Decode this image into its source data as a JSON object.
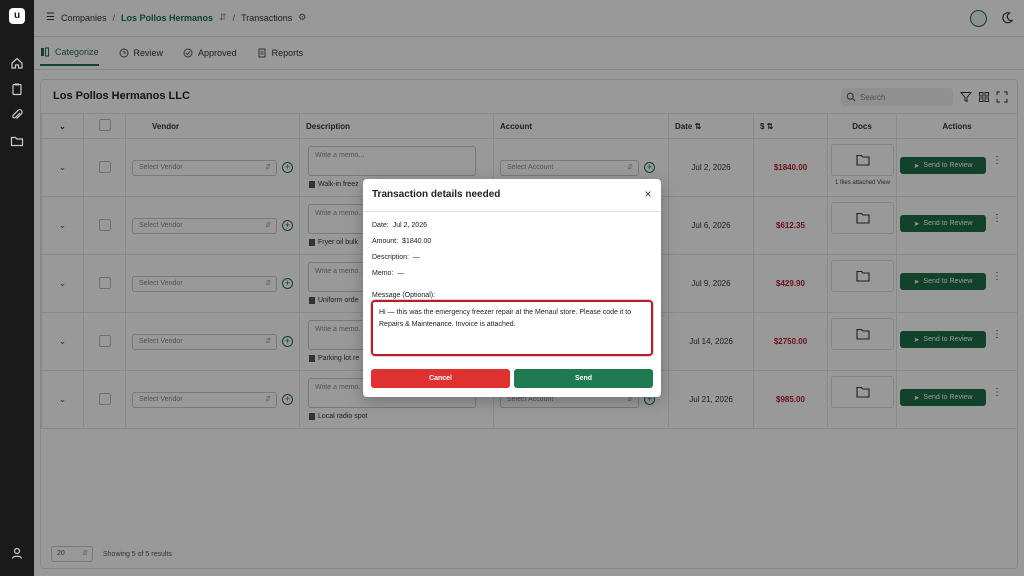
{
  "header": {
    "menu_icon": "hamburger-icon",
    "crumb_root": "Companies",
    "crumb_company": "Los Pollos Hermanos LLC",
    "crumb_sep": "/",
    "crumb_page": "Transactions"
  },
  "tabs": [
    {
      "label": "Categorize",
      "icon": "categorize-icon"
    },
    {
      "label": "Review",
      "icon": "clock-icon"
    },
    {
      "label": "Approved",
      "icon": "check-circle-icon"
    },
    {
      "label": "Reports",
      "icon": "document-icon"
    }
  ],
  "card": {
    "title": "Los Pollos Hermanos LLC",
    "search_placeholder": "Search"
  },
  "table": {
    "headers": {
      "vendor": "Vendor",
      "description": "Description",
      "account": "Account",
      "date": "Date ⇅",
      "amount": "$ ⇅",
      "docs": "Docs",
      "actions": "Actions"
    },
    "vendor_placeholder": "Select Vendor",
    "memo_placeholder": "Write a memo...",
    "account_placeholder": "Select Account",
    "send_label": "Send to Review",
    "rows": [
      {
        "desc": "Walk-in freez",
        "date": "Jul 2, 2026",
        "amount": "$1840.00",
        "docs_note": "1 files attached View"
      },
      {
        "desc": "Fryer oil bulk",
        "date": "Jul 6, 2026",
        "amount": "$612.35",
        "docs_note": ""
      },
      {
        "desc": "Uniform orde",
        "date": "Jul 9, 2026",
        "amount": "$429.90",
        "docs_note": ""
      },
      {
        "desc": "Parking lot re",
        "date": "Jul 14, 2026",
        "amount": "$2750.00",
        "docs_note": ""
      },
      {
        "desc": "Local radio spot",
        "date": "Jul 21, 2026",
        "amount": "$985.00",
        "docs_note": ""
      }
    ],
    "page_size": "20",
    "results_text": "Showing 5 of 5 results"
  },
  "modal": {
    "title": "Transaction details needed",
    "date_label": "Date:",
    "date_value": "Jul 2, 2026",
    "amount_label": "Amount:",
    "amount_value": "$1840.00",
    "description_label": "Description:",
    "description_value": "—",
    "memo_label": "Memo:",
    "memo_value": "—",
    "message_label": "Message (Optional):",
    "message_value": "Hi — this was the emergency freezer repair at the Menaul store. Please code it to Repairs & Maintenance. Invoice is attached.",
    "cancel_label": "Cancel",
    "send_label": "Send"
  },
  "colors": {
    "brand_green": "#1f6f4a",
    "amount_red": "#b21f2d",
    "cancel_red": "#e03131"
  }
}
